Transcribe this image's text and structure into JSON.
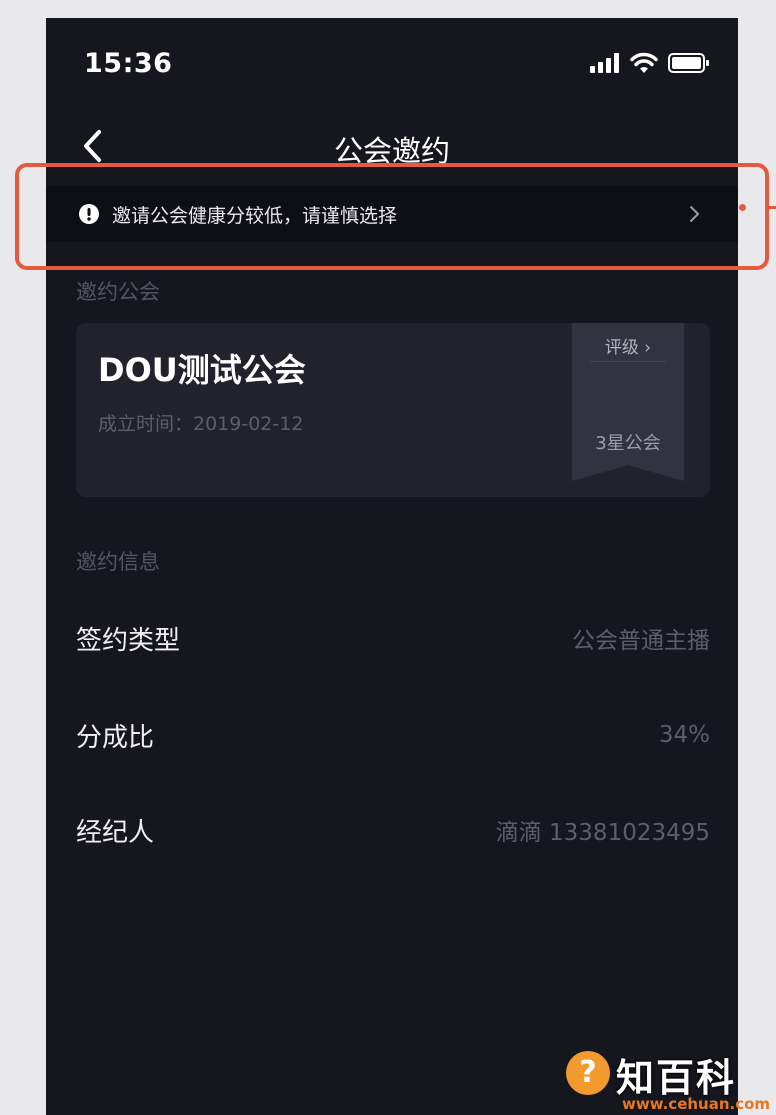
{
  "status_bar": {
    "time": "15:36"
  },
  "nav": {
    "title": "公会邀约"
  },
  "warning": {
    "text": "邀请公会健康分较低，请谨慎选择"
  },
  "guild_section": {
    "label": "邀约公会",
    "name": "DOU测试公会",
    "founded": "成立时间：2019-02-12",
    "rating_link": "评级 ›",
    "rating_value": "3星公会"
  },
  "invite_section": {
    "label": "邀约信息",
    "rows": [
      {
        "label": "签约类型",
        "value": "公会普通主播"
      },
      {
        "label": "分成比",
        "value": "34%"
      },
      {
        "label": "经纪人",
        "value": "滴滴 13381023495"
      }
    ]
  },
  "watermark": {
    "brand": "知百科",
    "url": "www.cehuan.com"
  },
  "colors": {
    "background": "#16161f",
    "banner": "#0e0e15",
    "card": "#22222d",
    "highlight": "#e55a3c"
  }
}
